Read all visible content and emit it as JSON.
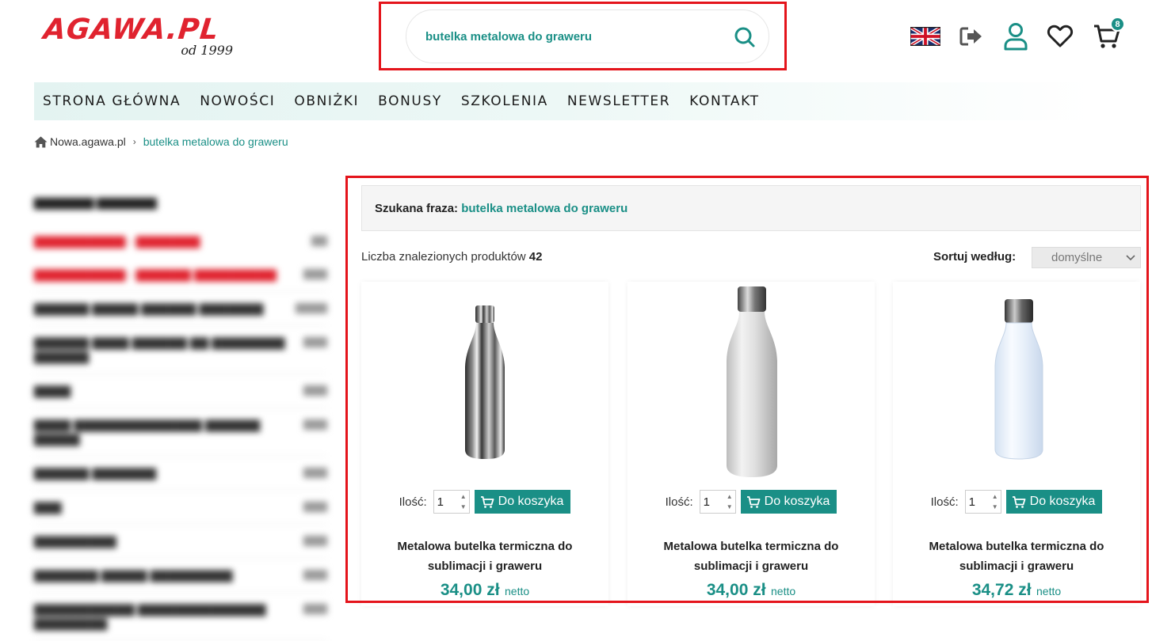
{
  "header": {
    "logo_text": "AGAWA.PL",
    "logo_subtitle": "od 1999",
    "search_value": "butelka metalowa do graweru",
    "cart_count": "8"
  },
  "nav": {
    "items": [
      "STRONA GŁÓWNA",
      "NOWOŚCI",
      "OBNIŻKI",
      "BONUSY",
      "SZKOLENIA",
      "NEWSLETTER",
      "KONTAKT"
    ]
  },
  "breadcrumb": {
    "home": "Nowa.agawa.pl",
    "current": "butelka metalowa do graweru"
  },
  "results": {
    "phrase_label": "Szukana fraza:",
    "phrase_value": "butelka metalowa do graweru",
    "count_label": "Liczba znalezionych produktów",
    "count_value": "42",
    "sort_label": "Sortuj według:",
    "sort_selected": "domyślne"
  },
  "products": [
    {
      "title": "Metalowa butelka termiczna do sublimacji i graweru",
      "price": "34,00 zł",
      "price_unit": "netto",
      "qty_label": "Ilość:",
      "qty": "1",
      "button": "Do koszyka",
      "variant": "steel"
    },
    {
      "title": "Metalowa butelka termiczna do sublimacji i graweru",
      "price": "34,00 zł",
      "price_unit": "netto",
      "qty_label": "Ilość:",
      "qty": "1",
      "button": "Do koszyka",
      "variant": "white"
    },
    {
      "title": "Metalowa butelka termiczna do sublimacji i graweru",
      "price": "34,72 zł",
      "price_unit": "netto",
      "qty_label": "Ilość:",
      "qty": "1",
      "button": "Do koszyka",
      "variant": "clear"
    }
  ],
  "colors": {
    "accent": "#1a8f86",
    "brand_red": "#e0232f",
    "highlight": "#e4141b"
  }
}
